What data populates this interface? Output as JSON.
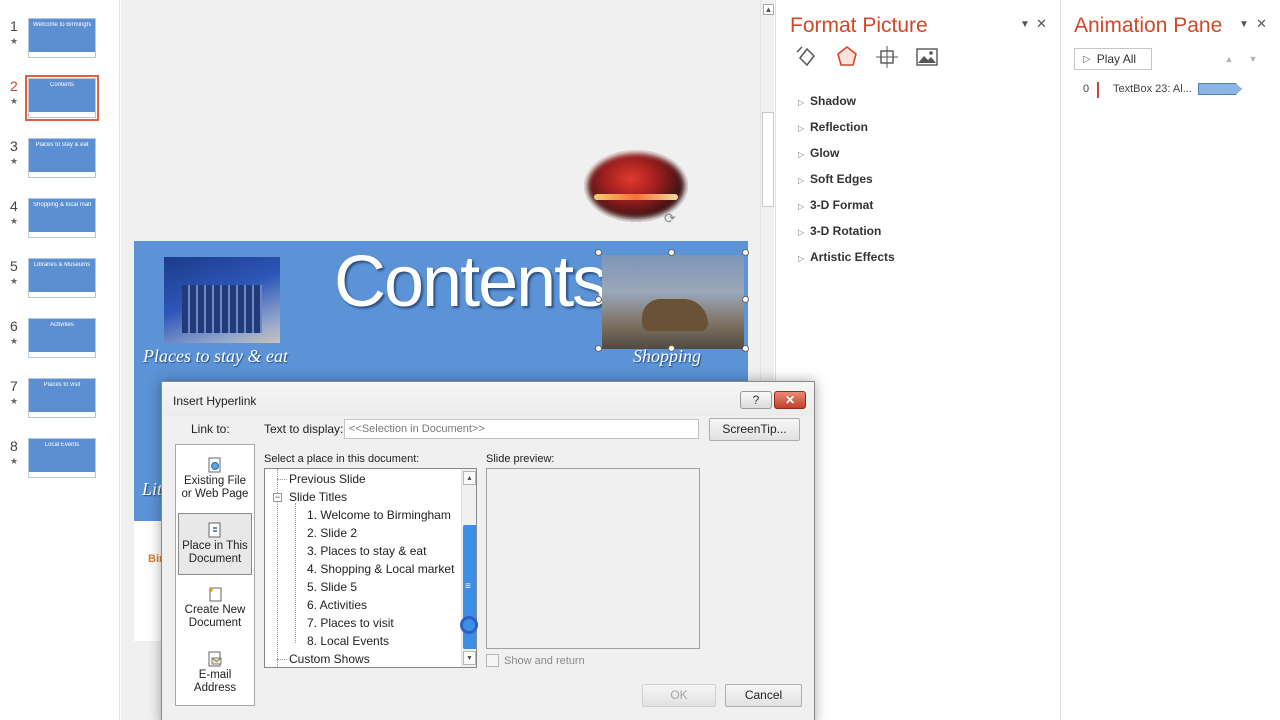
{
  "thumbnails": [
    {
      "num": "1",
      "title": "Welcome to Birmingham",
      "active": false
    },
    {
      "num": "2",
      "title": "Contents",
      "active": true
    },
    {
      "num": "3",
      "title": "Places to stay & eat",
      "active": false
    },
    {
      "num": "4",
      "title": "Shopping & local market",
      "active": false
    },
    {
      "num": "5",
      "title": "Libraries & Museums",
      "active": false
    },
    {
      "num": "6",
      "title": "Activities",
      "active": false
    },
    {
      "num": "7",
      "title": "Places to visit",
      "active": false
    },
    {
      "num": "8",
      "title": "Local Events",
      "active": false
    }
  ],
  "slide": {
    "title": "Contents",
    "label_left": "Places to stay & eat",
    "label_right": "Shopping",
    "label_partial": "Lit",
    "peek_text": "Bir"
  },
  "format_picture": {
    "title": "Format Picture",
    "sections": [
      "Shadow",
      "Reflection",
      "Glow",
      "Soft Edges",
      "3-D Format",
      "3-D Rotation",
      "Artistic Effects"
    ],
    "accent_color": "#d24726"
  },
  "animation_pane": {
    "title": "Animation Pane",
    "play_all": "Play All",
    "items": [
      {
        "index": "0",
        "name": "TextBox 23: Al..."
      }
    ]
  },
  "dialog": {
    "title": "Insert Hyperlink",
    "help": "?",
    "close": "✕",
    "link_to_label": "Link to:",
    "link_to_items": [
      {
        "line1": "Existing File",
        "line2": "or Web Page",
        "icon": "web-page-icon"
      },
      {
        "line1": "Place in This",
        "line2": "Document",
        "icon": "place-in-document-icon"
      },
      {
        "line1": "Create New",
        "line2": "Document",
        "icon": "new-document-icon"
      },
      {
        "line1": "E-mail",
        "line2": "Address",
        "icon": "email-icon"
      }
    ],
    "text_to_display_label": "Text to display:",
    "text_to_display_value": "<<Selection in Document>>",
    "screentip": "ScreenTip...",
    "place_label": "Select a place in this document:",
    "tree": {
      "previous_slide": "Previous Slide",
      "slide_titles": "Slide Titles",
      "slides": [
        "1. Welcome to Birmingham",
        "2. Slide 2",
        "3. Places to stay & eat",
        "4. Shopping & Local market",
        "5. Slide 5",
        "6. Activities",
        "7. Places to visit",
        "8. Local Events"
      ],
      "custom_shows": "Custom Shows"
    },
    "preview_label": "Slide preview:",
    "show_and_return": "Show and return",
    "ok": "OK",
    "cancel": "Cancel"
  }
}
